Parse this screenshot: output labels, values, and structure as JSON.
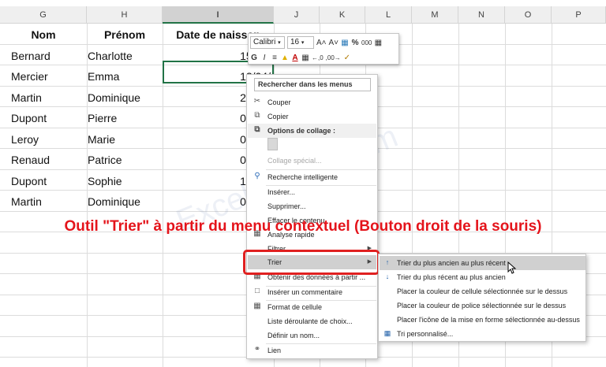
{
  "columns": [
    "G",
    "H",
    "I",
    "J",
    "K",
    "L",
    "M",
    "N",
    "O",
    "P"
  ],
  "active_column": "I",
  "table": {
    "headers": [
      "Nom",
      "Prénom",
      "Date de naissan"
    ],
    "rows": [
      {
        "nom": "Bernard",
        "prenom": "Charlotte",
        "date": "15/02/"
      },
      {
        "nom": "Mercier",
        "prenom": "Emma",
        "date": "12/04/"
      },
      {
        "nom": "Martin",
        "prenom": "Dominique",
        "date": "29/05/"
      },
      {
        "nom": "Dupont",
        "prenom": "Pierre",
        "date": "02/08/"
      },
      {
        "nom": "Leroy",
        "prenom": "Marie",
        "date": "03/01/"
      },
      {
        "nom": "Renaud",
        "prenom": "Patrice",
        "date": "05/12/"
      },
      {
        "nom": "Dupont",
        "prenom": "Sophie",
        "date": "14/03/"
      },
      {
        "nom": "Martin",
        "prenom": "Dominique",
        "date": "07/05/"
      }
    ]
  },
  "mini_toolbar": {
    "font_name": "Calibri",
    "font_size": "16",
    "bold": "G",
    "italic": "I",
    "grow_font": "A˄",
    "shrink_font": "A˅",
    "percent": "%",
    "thousands": "000",
    "increase_decimal": "←,0",
    "decrease_decimal": ",00→",
    "font_color_letter": "A"
  },
  "context_menu": {
    "search_label": "Rechercher dans les menus",
    "items": {
      "cut": "Couper",
      "copy": "Copier",
      "paste_options": "Options de collage :",
      "paste_special": "Collage spécial...",
      "smart_lookup": "Recherche intelligente",
      "insert": "Insérer...",
      "delete": "Supprimer...",
      "clear_contents": "Effacer le contenu",
      "quick_analysis": "Analyse rapide",
      "filter": "Filtrer",
      "sort": "Trier",
      "get_data": "Obtenir des données à partir ...",
      "insert_comment": "Insérer un commentaire",
      "format_cells": "Format de cellule",
      "dropdown_list": "Liste déroulante de choix...",
      "define_name": "Définir un nom...",
      "link": "Lien"
    }
  },
  "sort_submenu": {
    "items": [
      "Trier du plus ancien au plus récent",
      "Trier du plus récent au plus ancien",
      "Placer la couleur de cellule sélectionnée sur le dessus",
      "Placer la couleur de police sélectionnée sur le dessus",
      "Placer l'icône de la mise en forme sélectionnée au-dessus",
      "Tri personnalisé..."
    ]
  },
  "annotation": "Outil \"Trier\" à partir du menu contextuel (Bouton droit de la souris)",
  "watermark": "ExcelBonus.com",
  "colors": {
    "highlight_red": "#e02020",
    "annotation_red": "#e4141b",
    "selection_green": "#217346"
  }
}
